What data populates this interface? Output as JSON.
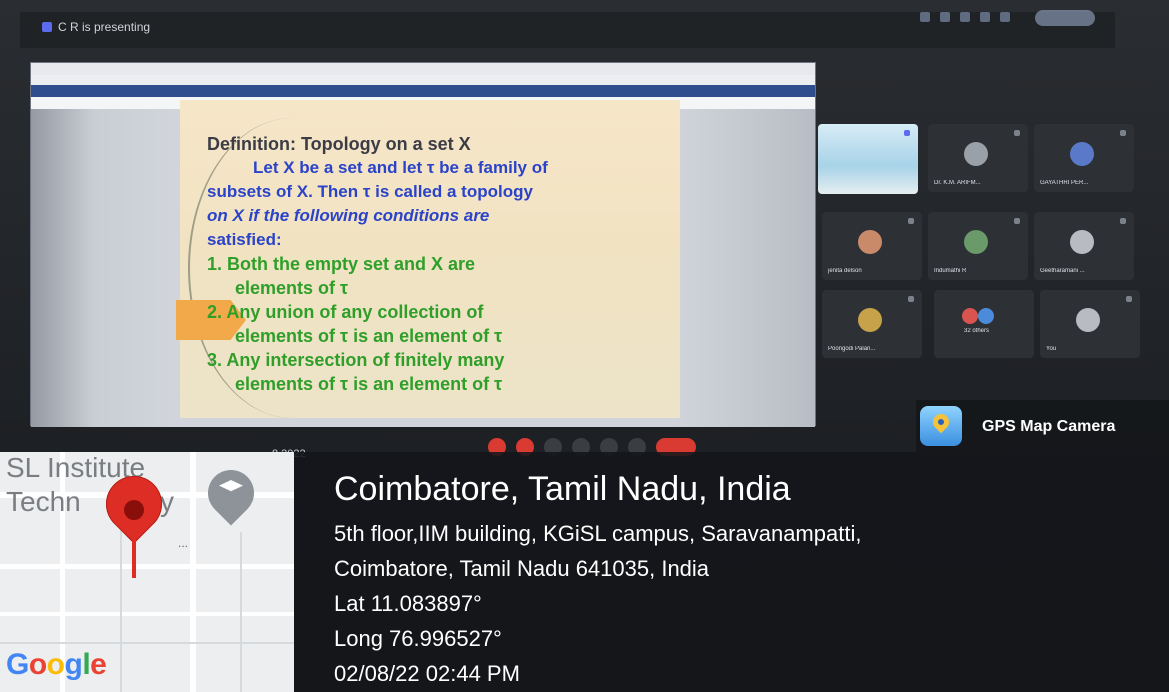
{
  "meeting": {
    "presenting_label": "C R is presenting",
    "date_fragment": "8.2022"
  },
  "slide": {
    "title": "Definition: Topology on a set  X",
    "lines": [
      "Let X be a set and let τ be a family of",
      "subsets of X. Then τ is called a topology",
      "on X if the following conditions are",
      "satisfied:"
    ],
    "conditions": [
      [
        "1. Both the empty set and X are",
        "elements of τ"
      ],
      [
        "2. Any union of any collection of",
        "elements of τ is an element of τ"
      ],
      [
        "3. Any intersection of finitely many",
        "elements of τ is an element of τ"
      ]
    ]
  },
  "participants": [
    {
      "name": "Dr. K.M. ARIFM..."
    },
    {
      "name": "GAYATHRI PER..."
    },
    {
      "name": "jenita delson"
    },
    {
      "name": "Indumathi R"
    },
    {
      "name": "Geetharamani ..."
    },
    {
      "name": "Poongodi Palan..."
    },
    {
      "name": "32 others"
    },
    {
      "name": "You"
    }
  ],
  "overlay": {
    "app_name": "GPS Map Camera",
    "city": "Coimbatore, Tamil Nadu, India",
    "address_line1": "5th floor,IIM building, KGiSL campus, Saravanampatti,",
    "address_line2": "Coimbatore, Tamil Nadu 641035, India",
    "lat": "Lat 11.083897°",
    "long": "Long 76.996527°",
    "datetime": "02/08/22 02:44 PM"
  },
  "map": {
    "label_line1": "SL Institute",
    "label_line2a": "Techn",
    "label_line2b": "y",
    "ellipsis": "...",
    "google": [
      "G",
      "o",
      "o",
      "g",
      "l",
      "e"
    ]
  }
}
